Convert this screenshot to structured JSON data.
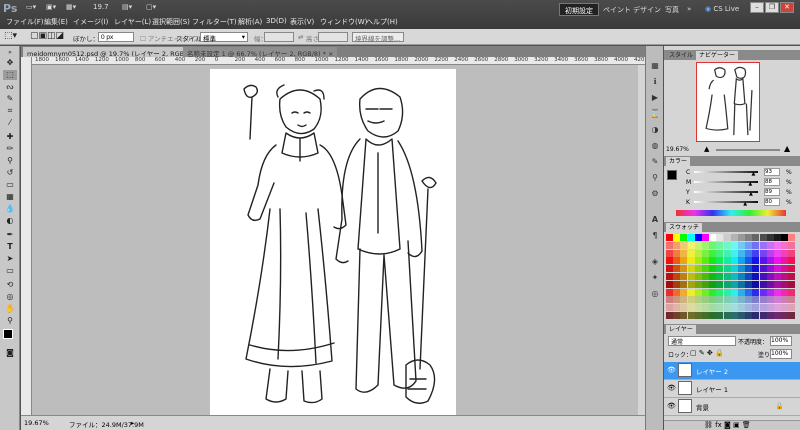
{
  "app": {
    "logo": "Ps",
    "zoom_value": "19.7"
  },
  "menu": [
    "ファイル(F)",
    "編集(E)",
    "イメージ(I)",
    "レイヤー(L)",
    "選択範囲(S)",
    "フィルター(T)",
    "解析(A)",
    "3D(D)",
    "表示(V)",
    "ウィンドウ(W)",
    "ヘルプ(H)"
  ],
  "workspaces": {
    "active": "初期設定",
    "items": [
      "ペイント",
      "デザイン",
      "写真"
    ],
    "more": "»",
    "cslive": "CS Live"
  },
  "window_controls": {
    "minimize": "–",
    "restore": "❐",
    "close": "✕"
  },
  "options": {
    "feather_label": "ぼかし：",
    "feather_value": "0 px",
    "antialias": "アンチエイリアス",
    "style_label": "スタイル：",
    "style_value": "標準",
    "width_label": "幅：",
    "height_label": "高さ：",
    "refine_button": "境界線を調整..."
  },
  "tabs": [
    {
      "label": "meidomnym0512.psd @ 19.7% (レイヤー 2, RGB/8) *",
      "close": "×"
    },
    {
      "label": "名称未設定 1 @ 66.7% (レイヤー 2, RGB/8) *",
      "close": "×"
    }
  ],
  "ruler_numbers": [
    "1800",
    "1600",
    "1400",
    "1200",
    "1000",
    "800",
    "600",
    "400",
    "200",
    "0",
    "200",
    "400",
    "600",
    "800",
    "1000",
    "1200",
    "1400",
    "1600",
    "1800",
    "2000",
    "2200",
    "2400",
    "2600",
    "2800",
    "3000",
    "3200",
    "3400",
    "3600",
    "3800",
    "4000",
    "420"
  ],
  "status": {
    "zoom": "19.67%",
    "file": "ファイル：24.9M/37.9M"
  },
  "navigator": {
    "tabs": [
      "スタイル",
      "ナビゲーター"
    ],
    "zoom": "19.67%"
  },
  "color": {
    "tab": "カラー",
    "sliders": [
      {
        "label": "C",
        "value": "93",
        "unit": "%",
        "fraction": 0.93
      },
      {
        "label": "M",
        "value": "88",
        "unit": "%",
        "fraction": 0.88
      },
      {
        "label": "Y",
        "value": "89",
        "unit": "%",
        "fraction": 0.89
      },
      {
        "label": "K",
        "value": "80",
        "unit": "%",
        "fraction": 0.8
      }
    ]
  },
  "swatches": {
    "tab": "スウォッチ"
  },
  "layers": {
    "tab": "レイヤー",
    "blend": "通常",
    "opacity_label": "不透明度：",
    "opacity_value": "100%",
    "lock_label": "ロック：",
    "fill_label": "塗り：",
    "fill_value": "100%",
    "items": [
      {
        "name": "レイヤー 2",
        "selected": true
      },
      {
        "name": "レイヤー 1",
        "selected": false
      },
      {
        "name": "背景",
        "selected": false
      }
    ]
  },
  "colors": {
    "accent": "#3a8ee6",
    "selected_layer": "#3c97f0",
    "foreground": "#000000",
    "background": "#ffffff"
  }
}
